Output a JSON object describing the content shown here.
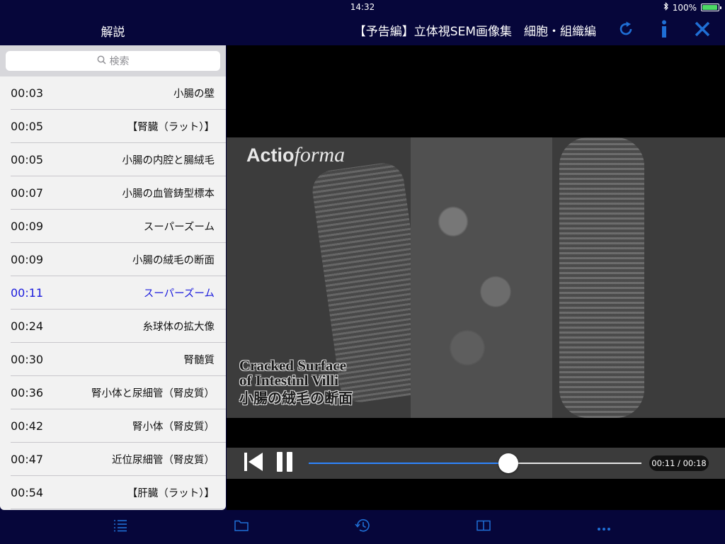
{
  "status_bar": {
    "device": "iPad",
    "time": "14:32",
    "battery": "100%"
  },
  "sidebar": {
    "title": "解説",
    "search_placeholder": "検索",
    "items": [
      {
        "time": "00:03",
        "label": "小腸の壁"
      },
      {
        "time": "00:05",
        "label": "【腎臓（ラット）】"
      },
      {
        "time": "00:05",
        "label": "小腸の内腔と腸絨毛"
      },
      {
        "time": "00:07",
        "label": "小腸の血管鋳型標本"
      },
      {
        "time": "00:09",
        "label": "スーパーズーム"
      },
      {
        "time": "00:09",
        "label": "小腸の絨毛の断面"
      },
      {
        "time": "00:11",
        "label": "スーパーズーム"
      },
      {
        "time": "00:24",
        "label": "糸球体の拡大像"
      },
      {
        "time": "00:30",
        "label": "腎髄質"
      },
      {
        "time": "00:36",
        "label": "腎小体と尿細管（腎皮質）"
      },
      {
        "time": "00:42",
        "label": "腎小体（腎皮質）"
      },
      {
        "time": "00:47",
        "label": "近位尿細管（腎皮質）"
      },
      {
        "time": "00:54",
        "label": "【肝臓（ラット）】"
      }
    ]
  },
  "navbar": {
    "title": "【予告編】立体視SEM画像集　細胞・組織編"
  },
  "video": {
    "brand_bold": "Actio",
    "brand_italic": "forma",
    "caption_en_1": "Cracked Surface",
    "caption_en_2": "of Intestinl Villi",
    "caption_jp": "小腸の絨毛の断面",
    "time_display": "00:11 / 00:18",
    "progress_fraction": 0.6
  },
  "colors": {
    "accent": "#1f6fd6",
    "nav_bg": "#06063a",
    "active_row": "#1a1adc"
  },
  "tabbar": {
    "icons": [
      "list-icon",
      "folder-icon",
      "history-icon",
      "book-icon",
      "more-icon"
    ]
  }
}
